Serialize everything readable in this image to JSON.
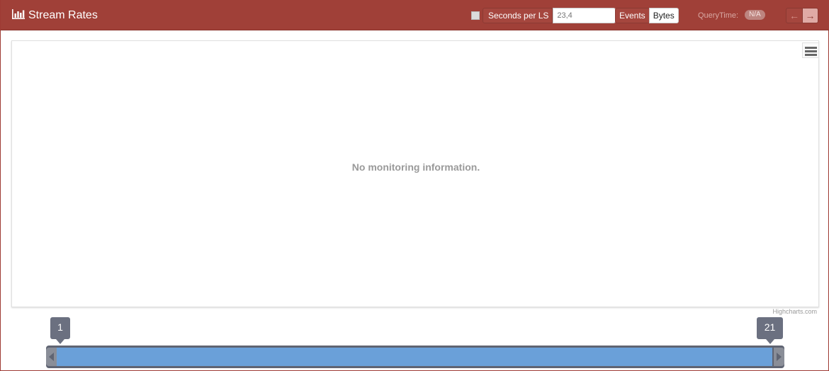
{
  "window": {
    "title": "Stream Rates",
    "title_icon": "bar-chart-icon"
  },
  "toolbar": {
    "seconds_label": "Seconds per LS",
    "seconds_checked": false,
    "seconds_placeholder": "23,4",
    "unit_options": [
      "Events",
      "Bytes"
    ],
    "unit_selected": "Bytes",
    "querytime_label": "QueryTime:",
    "querytime_value": "N/A",
    "prev_arrow": "←",
    "next_arrow": "→"
  },
  "chart": {
    "empty_message": "No monitoring information.",
    "credits": "Highcharts.com",
    "menu_icon": "menu-icon"
  },
  "range_slider": {
    "min_label": "1",
    "max_label": "21",
    "range_min": 1,
    "range_max": 21,
    "handle_color": "#6aa0d9"
  },
  "colors": {
    "header": "#a04038",
    "accent": "#6aa0d9"
  }
}
